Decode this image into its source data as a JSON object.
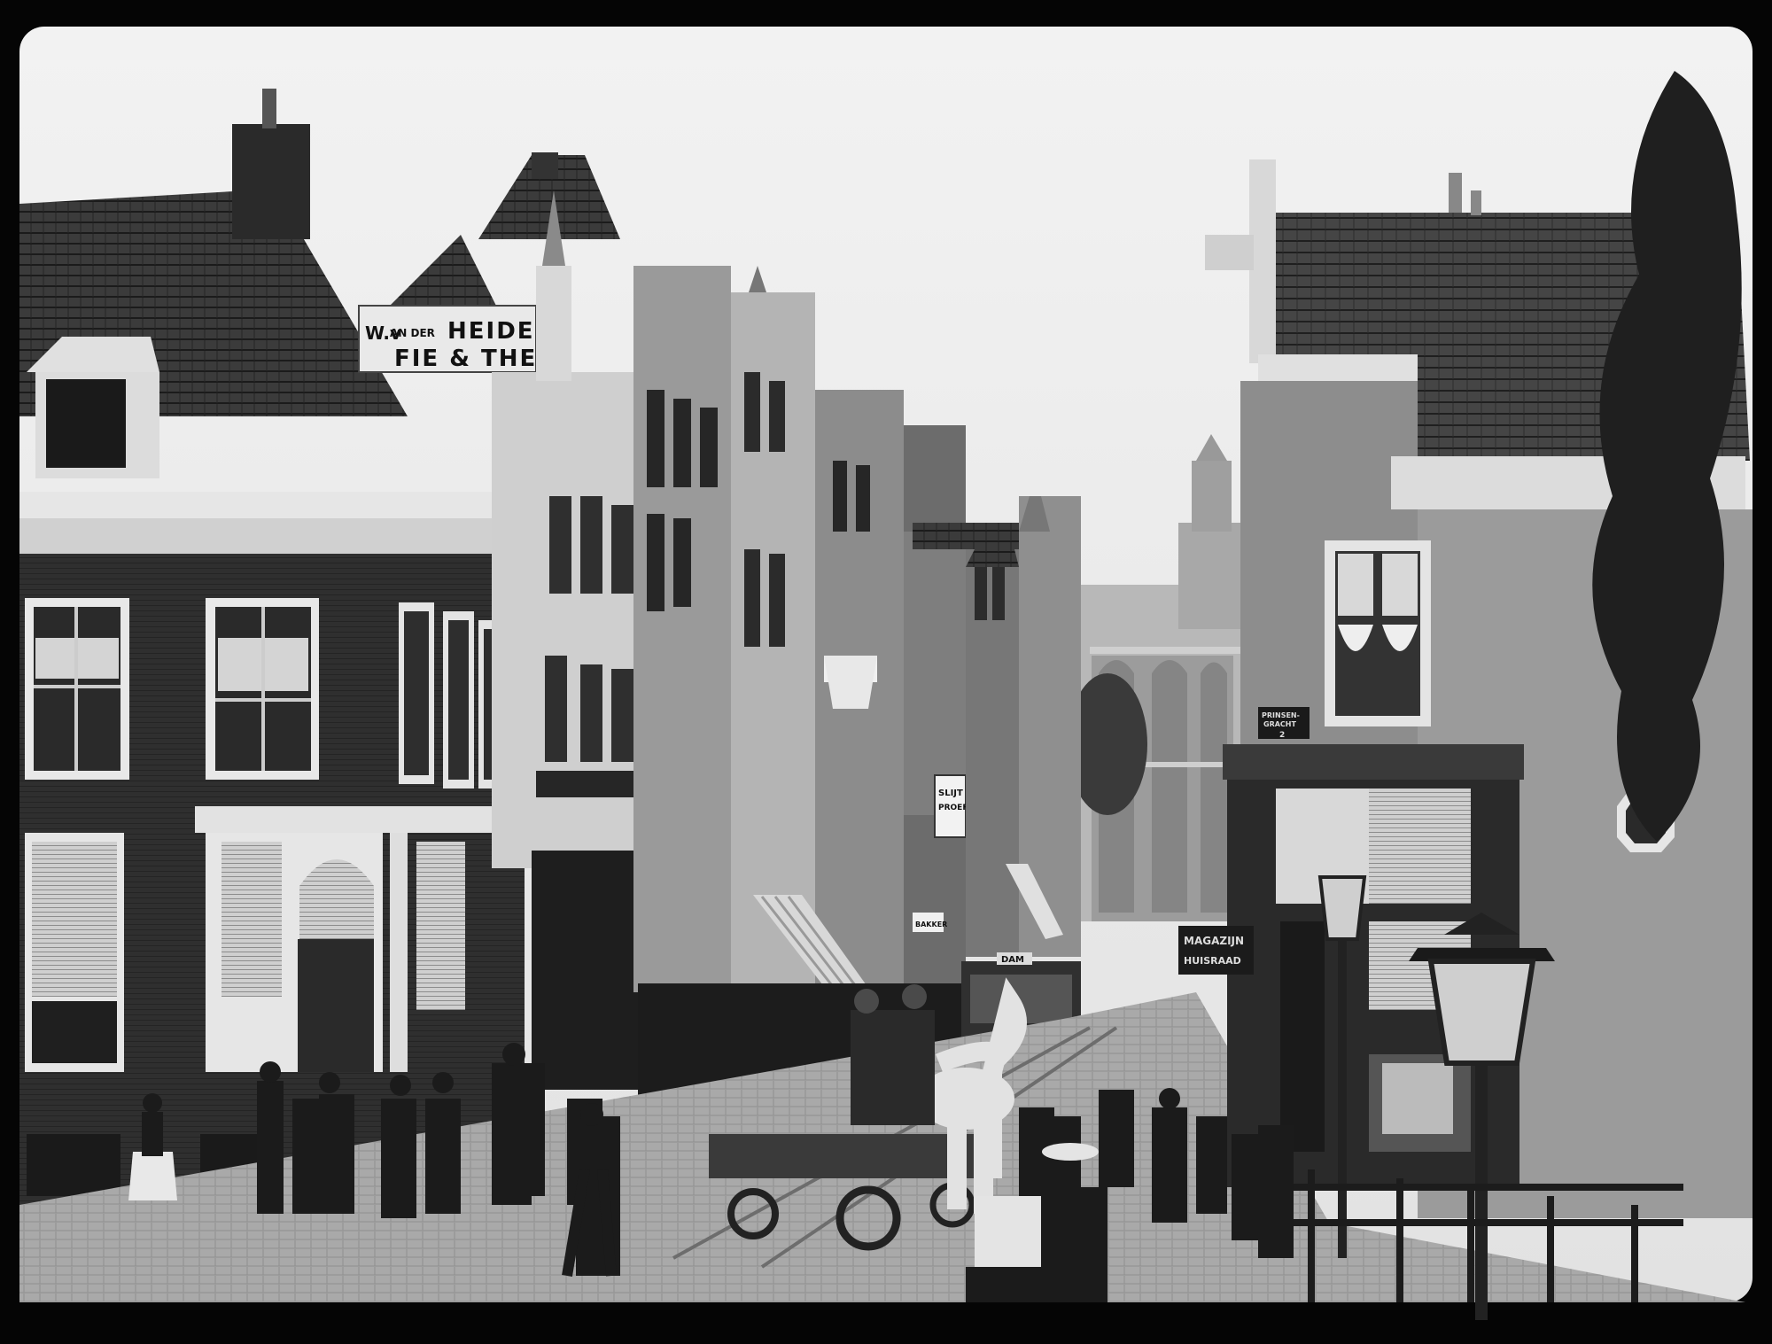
{
  "image": {
    "kind": "black-and-white photograph",
    "subject": "street scene with shop fronts, horse-drawn cart, tram and pedestrians"
  },
  "signs": {
    "heide_top_left": "W.v",
    "heide_top_small": "AN DER",
    "heide_top_main": "HEIDE.",
    "heide_bottom": "FIE & THEE",
    "tram_destination": "DAM",
    "street_sign_line1": "PRINSEN-",
    "street_sign_line2": "GRACHT",
    "street_sign_number": "2",
    "magazijn_line1": "MAGAZIJN",
    "magazijn_line2": "HUISRAAD",
    "shop_sign_line1": "SLIJT",
    "shop_sign_line2": "PROEF",
    "awning_sign": "BAKKER"
  }
}
